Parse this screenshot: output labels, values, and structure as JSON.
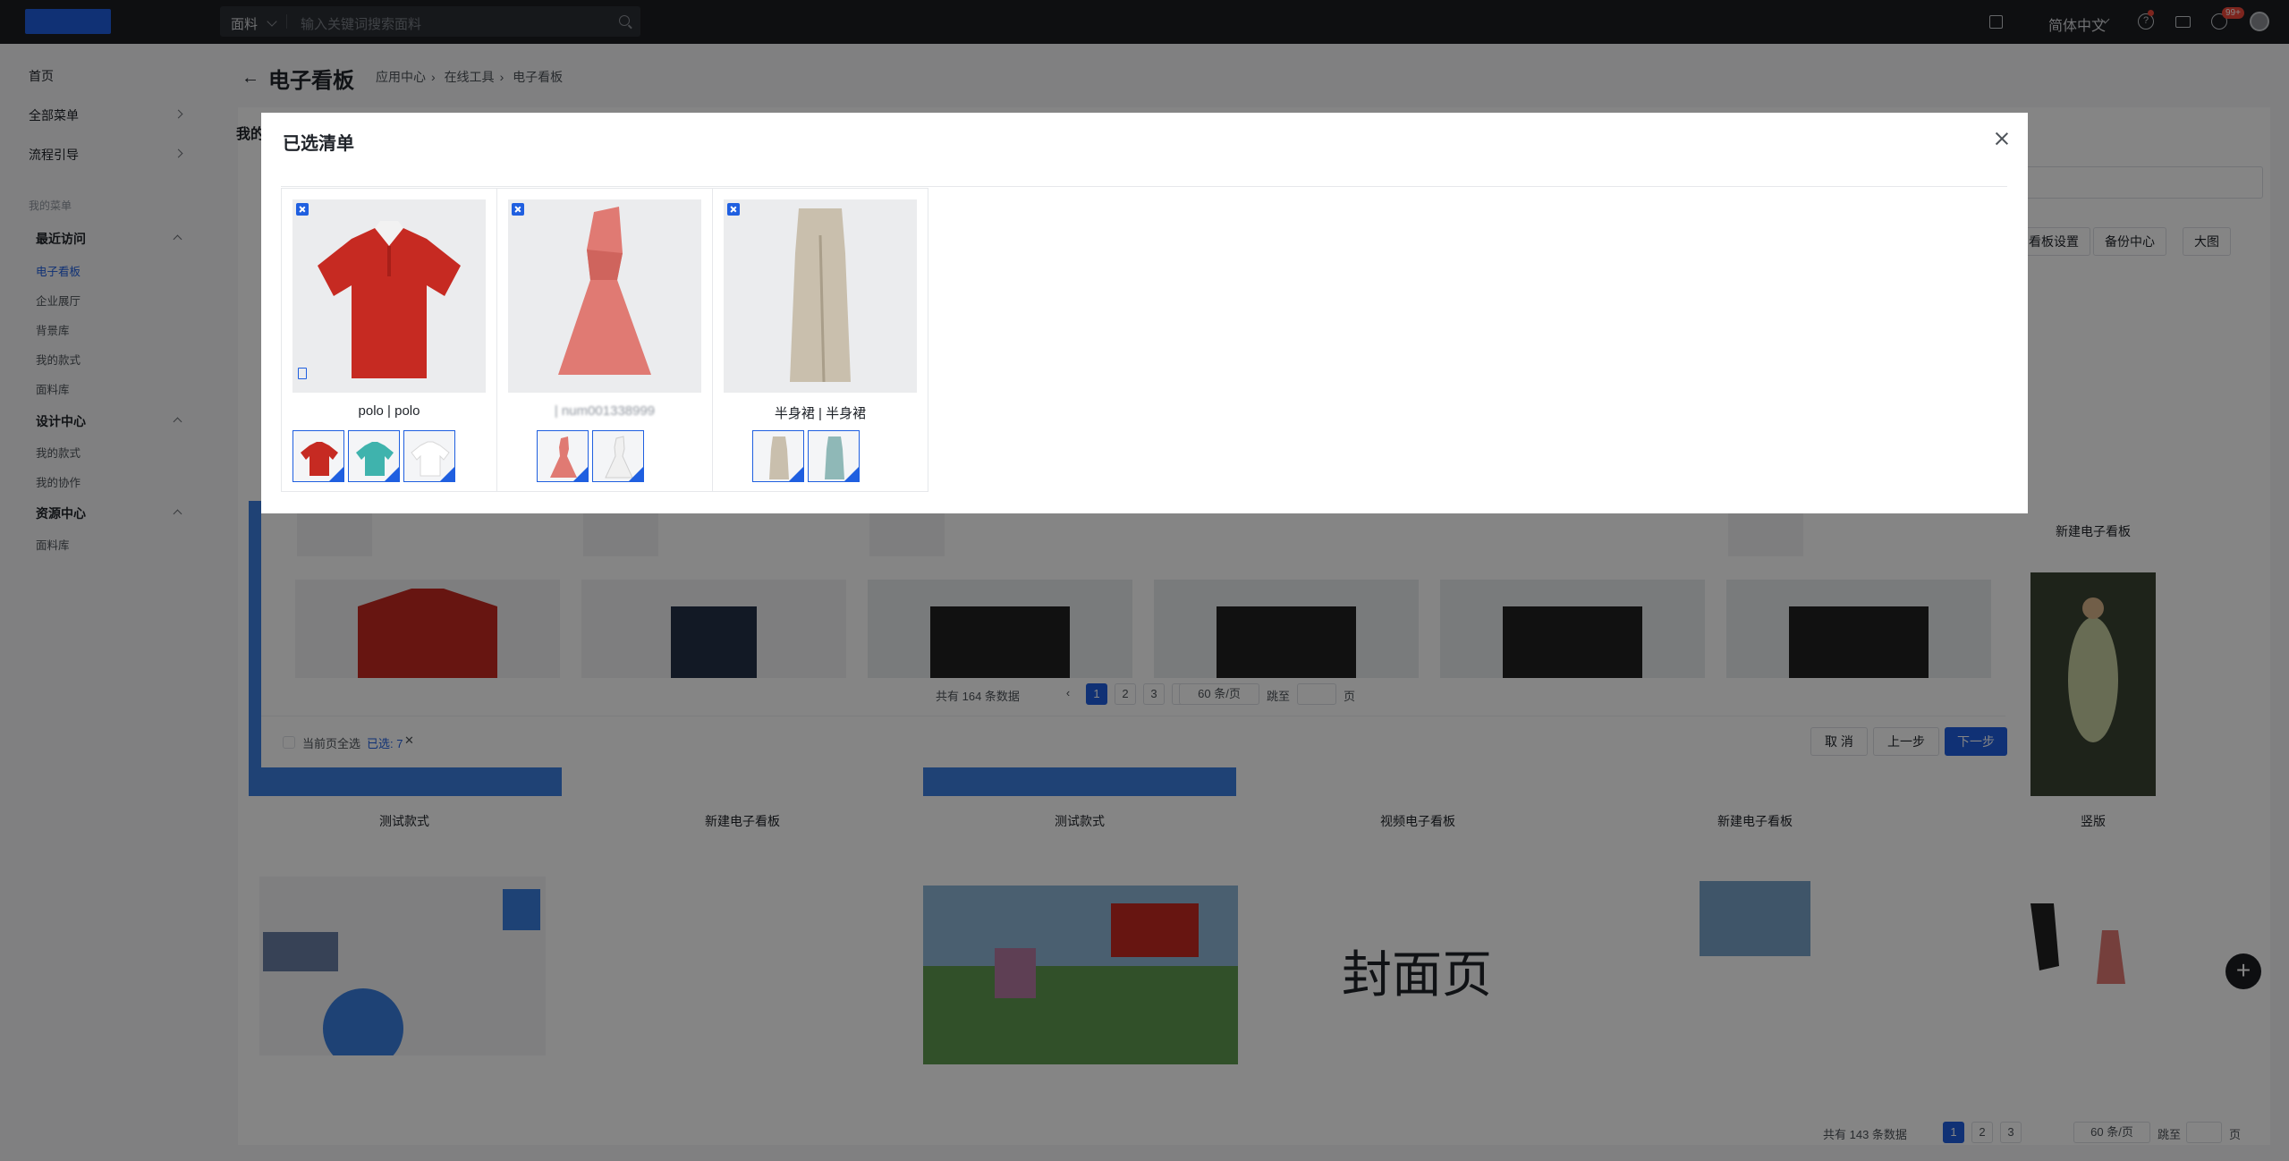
{
  "topbar": {
    "search_category": "面料",
    "search_placeholder": "输入关键词搜索面料",
    "language": "简体中文",
    "notification_badge": "99+"
  },
  "sidebar": {
    "home": "首页",
    "all_menu": "全部菜单",
    "process_guide": "流程引导",
    "my_menu_caption": "我的菜单",
    "groups": [
      {
        "title": "最近访问",
        "items": [
          "电子看板",
          "企业展厅",
          "背景库",
          "我的款式",
          "面料库"
        ]
      },
      {
        "title": "设计中心",
        "items": [
          "我的款式",
          "我的协作"
        ]
      },
      {
        "title": "资源中心",
        "items": [
          "面料库"
        ]
      }
    ]
  },
  "header": {
    "title": "电子看板",
    "breadcrumb": [
      "应用中心",
      "在线工具",
      "电子看板"
    ],
    "tab_mine": "我的"
  },
  "toolbar": {
    "board_settings": "看板设置",
    "backup_center": "备份中心",
    "view_mode": "大图"
  },
  "background": {
    "labels": [
      "测试款式",
      "新建电子看板",
      "测试款式",
      "视频电子看板",
      "新建电子看板",
      "竖版",
      "新建电子看板"
    ],
    "cover_text": "封面页",
    "pagination": {
      "total": "共有 143 条数据",
      "pages": [
        "1",
        "2",
        "3"
      ],
      "per_page": "60 条/页",
      "jump": "跳至",
      "page_unit": "页"
    }
  },
  "under_dialog": {
    "pagination": {
      "total": "共有 164 条数据",
      "pages": [
        "1",
        "2",
        "3"
      ],
      "per_page": "60 条/页",
      "jump": "跳至",
      "page_unit": "页"
    },
    "select_all": "当前页全选",
    "selected": "已选: 7",
    "cancel": "取 消",
    "prev": "上一步",
    "next": "下一步"
  },
  "modal": {
    "title": "已选清单",
    "items": [
      {
        "name": "polo | polo",
        "main_color": "#c62a22",
        "variants": [
          "#c62a22",
          "#3fb3ad",
          "#f4f4f4"
        ]
      },
      {
        "name": "| num001338999",
        "main_color": "#e07a73",
        "variants": [
          "#e07a73",
          "#ececec"
        ]
      },
      {
        "name": "半身裙 | 半身裙",
        "main_color": "#c9bfad",
        "variants": [
          "#c9bfad",
          "#8fb8b7"
        ]
      }
    ]
  }
}
